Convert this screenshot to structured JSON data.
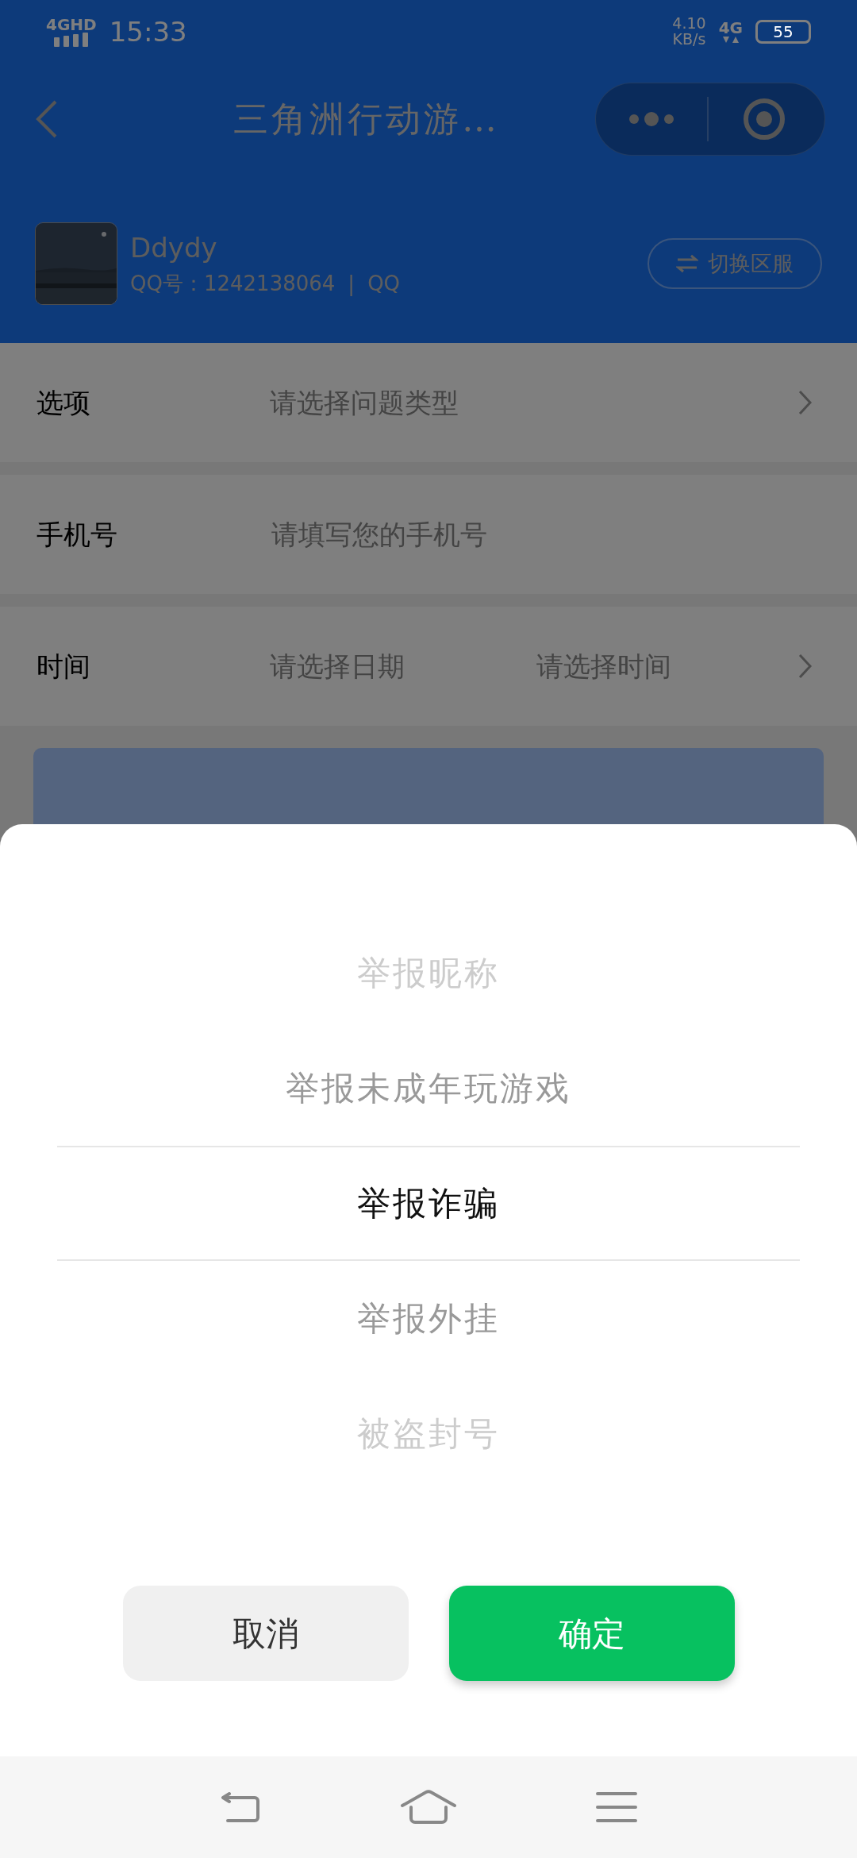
{
  "status_bar": {
    "network": "4GHD",
    "time": "15:33",
    "speed": "4.10",
    "speed_unit": "KB/s",
    "mobile": "4G",
    "battery": "55"
  },
  "header": {
    "title": "三角洲行动游…"
  },
  "profile": {
    "name": "Ddydy",
    "account": "QQ号：1242138064",
    "separator": "|",
    "platform": "QQ",
    "switch_button": "切换区服"
  },
  "form": [
    {
      "kind": "select",
      "label": "选项",
      "placeholders": [
        "请选择问题类型"
      ]
    },
    {
      "kind": "input",
      "label": "手机号",
      "placeholders": [
        "请填写您的手机号"
      ]
    },
    {
      "kind": "select",
      "label": "时间",
      "placeholders": [
        "请选择日期",
        "请选择时间"
      ]
    }
  ],
  "submit_button": {
    "shown": true
  },
  "picker": {
    "items": [
      {
        "label": "举报昵称",
        "selected": false
      },
      {
        "label": "举报未成年玩游戏",
        "selected": false
      },
      {
        "label": "举报诈骗",
        "selected": true
      },
      {
        "label": "举报外挂",
        "selected": false
      },
      {
        "label": "被盗封号",
        "selected": false
      }
    ],
    "cancel": "取消",
    "confirm": "确定"
  }
}
